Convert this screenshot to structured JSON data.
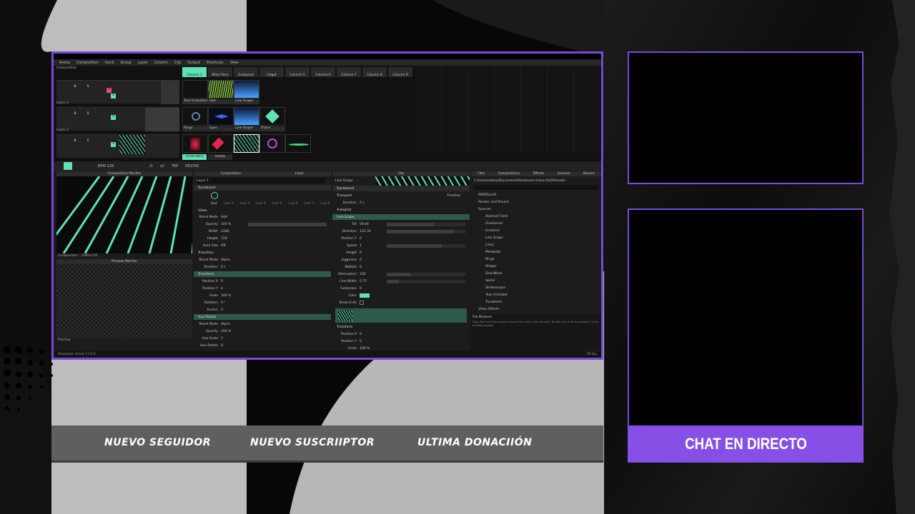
{
  "app": {
    "menu": [
      "Arena",
      "Composition",
      "Deck",
      "Group",
      "Layer",
      "Column",
      "Clip",
      "Output",
      "Shortcuts",
      "View"
    ],
    "composition_label": "Composition",
    "columns": [
      "Column 1",
      "Mirro Face",
      "Godspeed",
      "Fidget",
      "Column 5",
      "Column 6",
      "Column 7",
      "Column 8",
      "Column 9"
    ],
    "layers": [
      "Layer 3",
      "Layer 2",
      "Layer 1"
    ],
    "clips_row1": [
      "Text Animation",
      "Hair",
      "Line Scape"
    ],
    "clips_row2": [
      "Rings",
      "Eyes",
      "Line Scape",
      "Trains"
    ],
    "deck_tabs": [
      "Generators",
      "empty"
    ],
    "transport": {
      "bpm": "BPM 128",
      "div": "/2",
      "mul": "x2",
      "tap": "TAP",
      "resync": "RESYNC"
    },
    "panes": {
      "comp_monitor": "Composition Monitor",
      "comp_size": "Composition - 1280x720",
      "preview_monitor": "Preview Monitor",
      "preview_label": "Preview",
      "composition": "Composition",
      "layer": "Layer",
      "clip": "Clip",
      "files": "Files",
      "compositions": "Compositions",
      "effects": "Effects",
      "sources": "Sources",
      "record": "Record"
    },
    "layer_panel": {
      "name": "Layer 1",
      "dashboard": "Dashboard",
      "hue": "Hue",
      "links": [
        "Link 2",
        "Link 3",
        "Link 4",
        "Link 5",
        "Link 6",
        "Link 7",
        "Link 8"
      ],
      "video": "Video",
      "blend_mode": [
        "Blend Mode",
        "Add"
      ],
      "opacity": [
        "Opacity",
        "100 %"
      ],
      "width": [
        "Width",
        "1280"
      ],
      "height": [
        "Height",
        "720"
      ],
      "auto_size": [
        "Auto Size",
        "Off"
      ],
      "transition": "Transition",
      "t_blend": [
        "Blend Mode",
        "Alpha"
      ],
      "duration": [
        "Duration",
        "0 s"
      ],
      "transform": "Transform",
      "pos_x": [
        "Position X",
        "0"
      ],
      "pos_y": [
        "Position Y",
        "0"
      ],
      "scale": [
        "Scale",
        "100 %"
      ],
      "rotation": [
        "Rotation",
        "0 °"
      ],
      "anchor": [
        "Anchor",
        "0"
      ],
      "hue_rotate": "Hue Rotate",
      "h_blend": [
        "Blend Mode",
        "Alpha"
      ],
      "h_opacity": [
        "Opacity",
        "100 %"
      ],
      "hue_scale": [
        "Hue Scale",
        "1"
      ],
      "hue_rot": [
        "Hue Rotate",
        "0"
      ]
    },
    "clip_panel": {
      "name": "Line Scape",
      "dashboard": "Dashboard",
      "transport": "Transport",
      "timeline": "Timeline",
      "duration": [
        "Duration",
        "5 s"
      ],
      "autopilot": "Autopilot",
      "section": "Line Scape",
      "params": [
        [
          "Tilt",
          "59.84"
        ],
        [
          "Direction",
          "122.34"
        ],
        [
          "Position Y",
          "0"
        ],
        [
          "Speed",
          "1"
        ],
        [
          "Height",
          "0"
        ],
        [
          "Jagginess",
          "0"
        ],
        [
          "Wobble",
          "0"
        ],
        [
          "Attenuation",
          "100"
        ],
        [
          "Line Width",
          "0.75"
        ],
        [
          "Fuzzyness",
          "0"
        ],
        [
          "Color",
          ""
        ],
        [
          "Show Ends",
          ""
        ]
      ],
      "transform": "Transform",
      "t_pos_x": [
        "Position X",
        "0"
      ],
      "t_pos_y": [
        "Position Y",
        "0"
      ],
      "t_scale": [
        "Scale",
        "100 %"
      ]
    },
    "files_panel": {
      "path": "C:\\Users\\sebas\\Documents\\Resolume Arena OLD\\Presets",
      "tree": [
        "PANTALLAS",
        "Render and Record",
        "Sources",
        "Abstract Field",
        "Checkered",
        "Gradient",
        "Line Scape",
        "Lines",
        "Metaballs",
        "Rings",
        "Shaper",
        "Sine-Wave",
        "Spiral",
        "Stroboscope",
        "Text Animator",
        "Turnwheel",
        "Video Effects"
      ],
      "browser_title": "File Browser",
      "browser_hint": "Drag files from the browser to one of the clips in the clip deck. Double click a file to preview it in the preview monitor."
    },
    "status": "Resolume Arena 7.14.0",
    "fps": "60 fps"
  },
  "overlay": {
    "alerts": [
      "NUEVO SEGUIDOR",
      "NUEVO SUSCRIIPTOR",
      "ULTIMA DONACIIÓN"
    ],
    "chat": "CHAT EN DIRECTO"
  },
  "colors": {
    "accent": "#7a4bd6",
    "chat_bg": "#8650e6",
    "mint": "#5fe0b5",
    "alert_bar": "#5f5f5f"
  }
}
